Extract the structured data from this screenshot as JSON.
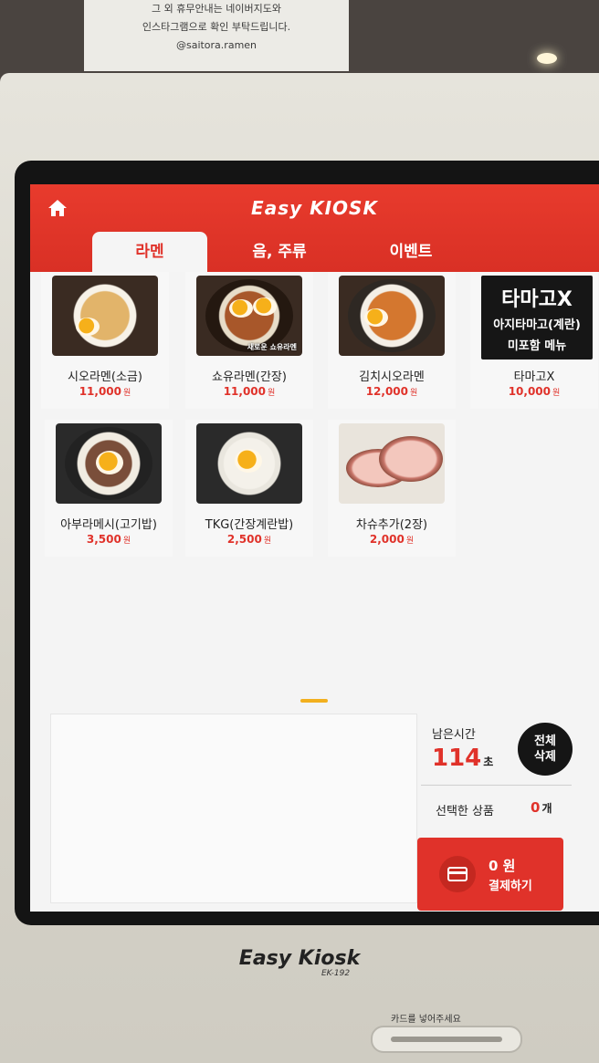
{
  "notice": {
    "line1": "그 외 휴무안내는 네이버지도와",
    "line2": "인스타그램으로 확인 부탁드립니다.",
    "line3": "@saitora.ramen"
  },
  "header": {
    "brand": "Easy KIOSK",
    "home_icon": "home-icon",
    "tabs": [
      {
        "label": "라멘",
        "active": true
      },
      {
        "label": "음, 주류",
        "active": false
      },
      {
        "label": "이벤트",
        "active": false
      }
    ]
  },
  "menu": {
    "currency": "원",
    "items": [
      {
        "name": "시오라멘(소금)",
        "price": "11,000"
      },
      {
        "name": "쇼유라멘(간장)",
        "price": "11,000",
        "image_caption": "새로운 쇼유라멘"
      },
      {
        "name": "김치시오라멘",
        "price": "12,000"
      },
      {
        "name": "타마고X",
        "price": "10,000",
        "card_title": "타마고X",
        "card_line1": "아지타마고(계란)",
        "card_line2": "미포함 메뉴"
      },
      {
        "name": "아부라메시(고기밥)",
        "price": "3,500"
      },
      {
        "name": "TKG(간장계란밥)",
        "price": "2,500"
      },
      {
        "name": "차슈추가(2장)",
        "price": "2,000"
      }
    ]
  },
  "order": {
    "time_label": "남은시간",
    "time_value": "114",
    "time_unit": "초",
    "clear_line1": "전체",
    "clear_line2": "삭제",
    "selected_label": "선택한 상품",
    "selected_count": "0",
    "selected_unit": "개",
    "pay_amount": "0 원",
    "pay_label": "결제하기"
  },
  "device": {
    "brand": "Easy Kiosk",
    "model": "EK-192",
    "card_hint": "카드를 넣어주세요"
  }
}
